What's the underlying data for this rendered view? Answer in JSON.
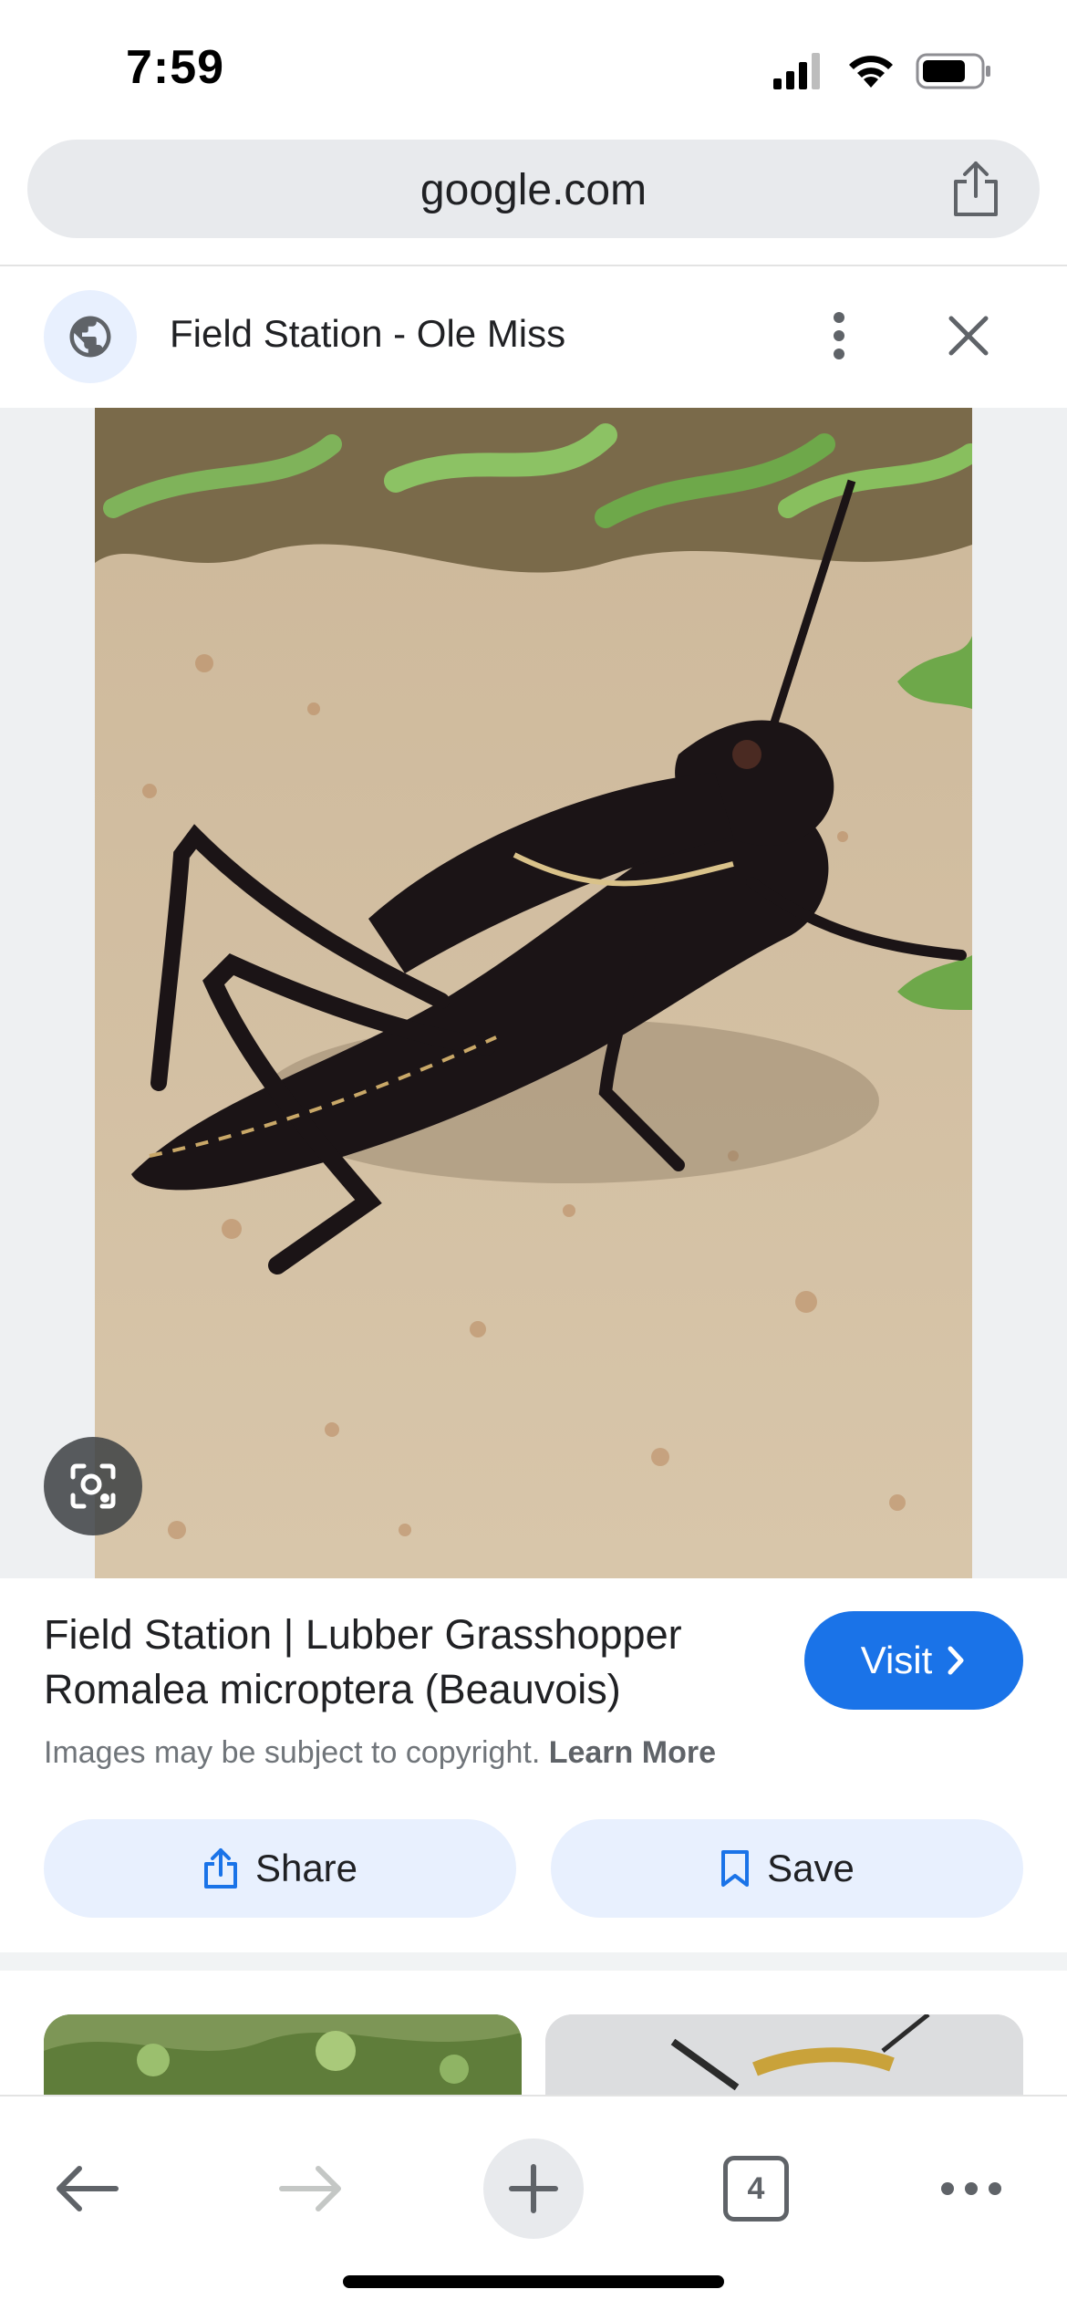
{
  "status_bar": {
    "time": "7:59",
    "icons": [
      "cellular-signal-icon",
      "wifi-icon",
      "battery-icon"
    ]
  },
  "browser": {
    "url": "google.com",
    "share_icon": "share-icon"
  },
  "site_header": {
    "title": "Field Station - Ole Miss",
    "icons": [
      "globe-icon",
      "more-vert-icon",
      "close-icon"
    ]
  },
  "image": {
    "subject": "Black lubber grasshopper on sandy ground",
    "lens_icon": "lens-icon"
  },
  "result": {
    "title_line1": "Field Station | Lubber Grasshopper",
    "title_line2": "Romalea microptera (Beauvois)",
    "visit_label": "Visit",
    "copyright_text": "Images may be subject to copyright.",
    "learn_more_label": "Learn More"
  },
  "actions": {
    "share_label": "Share",
    "save_label": "Save"
  },
  "toolbar": {
    "tab_count": "4",
    "icons": [
      "back-arrow-icon",
      "forward-arrow-icon",
      "plus-icon",
      "tabs-icon",
      "more-horiz-icon"
    ]
  },
  "colors": {
    "accent": "#1a73e8",
    "button_bg": "#e8f0fe",
    "url_bar_bg": "#e8eaed"
  }
}
